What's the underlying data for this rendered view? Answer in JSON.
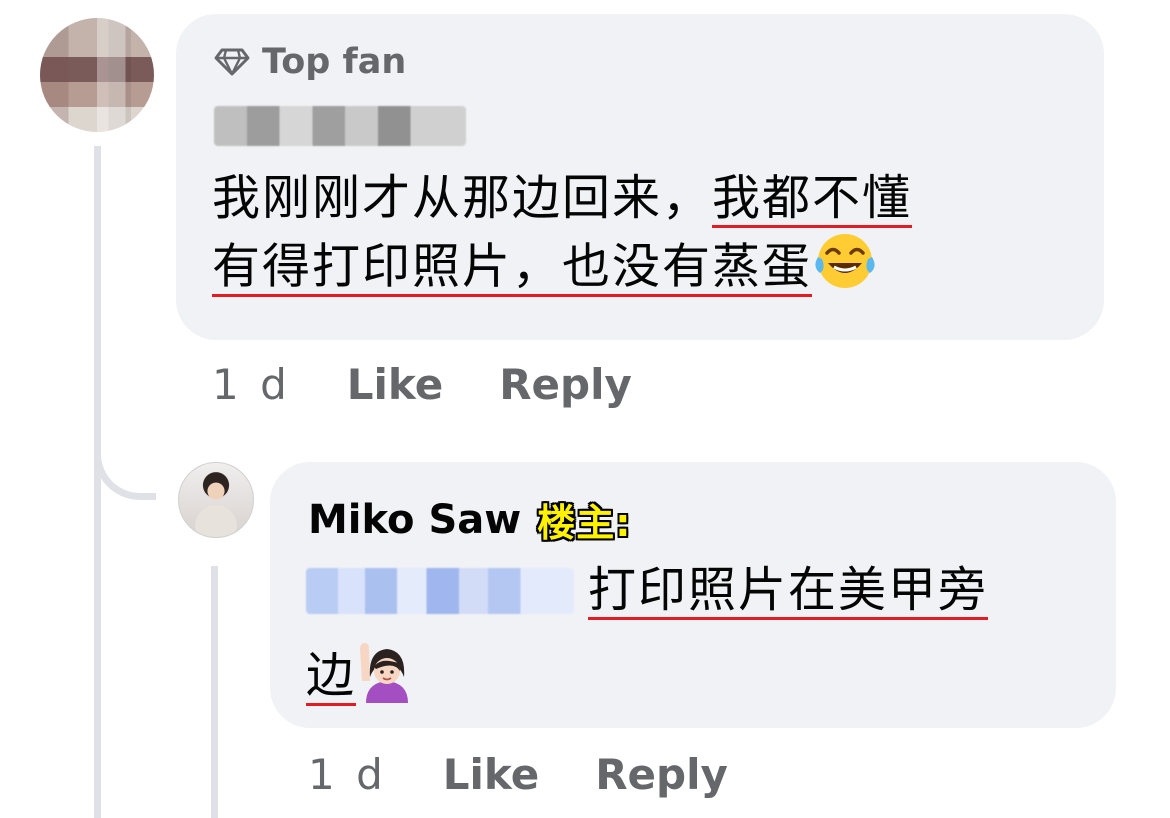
{
  "comment": {
    "badge_label": "Top fan",
    "line1_plain": "我刚刚才从那边回来，",
    "line1_underlined": "我都不懂",
    "line2_underlined": "有得打印照片，也没有蒸蛋",
    "emoji": "joy-tears",
    "time": "1 d",
    "like_label": "Like",
    "reply_label": "Reply"
  },
  "reply": {
    "author": "Miko Saw",
    "op_badge": "楼主:",
    "line1_underlined": "打印照片在美甲旁",
    "line2_underlined": "边",
    "emoji": "person-raising-hand",
    "time": "1 d",
    "like_label": "Like",
    "reply_label": "Reply"
  },
  "colors": {
    "bubble": "#f0f2f5",
    "meta_text": "#65676b",
    "underline": "#e31b23",
    "op_badge_fill": "#fff200",
    "thread_line": "#dfe1e6"
  }
}
